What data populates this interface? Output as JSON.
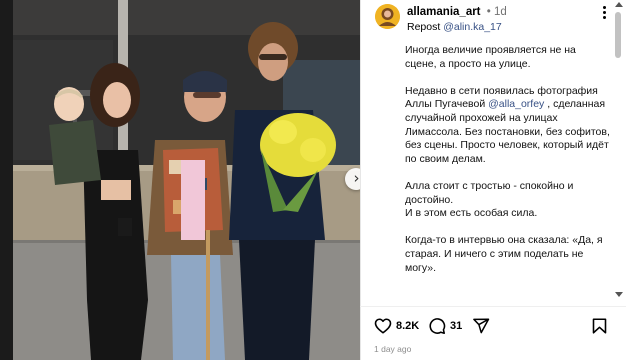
{
  "post": {
    "username": "allamania_art",
    "time": "1d",
    "repost_prefix": "Repost",
    "repost_handle": "@alin.ka_17",
    "caption": {
      "p1": "Иногда величие проявляется не на сцене, а просто на улице.",
      "p2_before": "Недавно в сети появилась фотография Аллы Пугачевой ",
      "p2_mention": "@alla_orfey",
      "p2_after": " , сделанная случайной прохожей на улицах Лимассола. Без постановки, без софитов, без сцены. Просто человек, который идёт по своим делам.",
      "p3": "Алла стоит с тростью - спокойно и достойно.",
      "p4": "И в этом есть особая сила.",
      "p5": "Когда-то в интервью она сказала: «Да, я старая. И ничего с этим поделать не могу»."
    },
    "likes": "8.2K",
    "comments": "31",
    "date": "1 day ago"
  },
  "icons": {
    "like": "heart-icon",
    "comment": "comment-icon",
    "share": "send-icon",
    "save": "bookmark-icon",
    "more": "more-icon",
    "next": "chevron-right-icon"
  },
  "colors": {
    "mention": "#385185",
    "muted": "#737373",
    "avatar": "#f0b323"
  }
}
